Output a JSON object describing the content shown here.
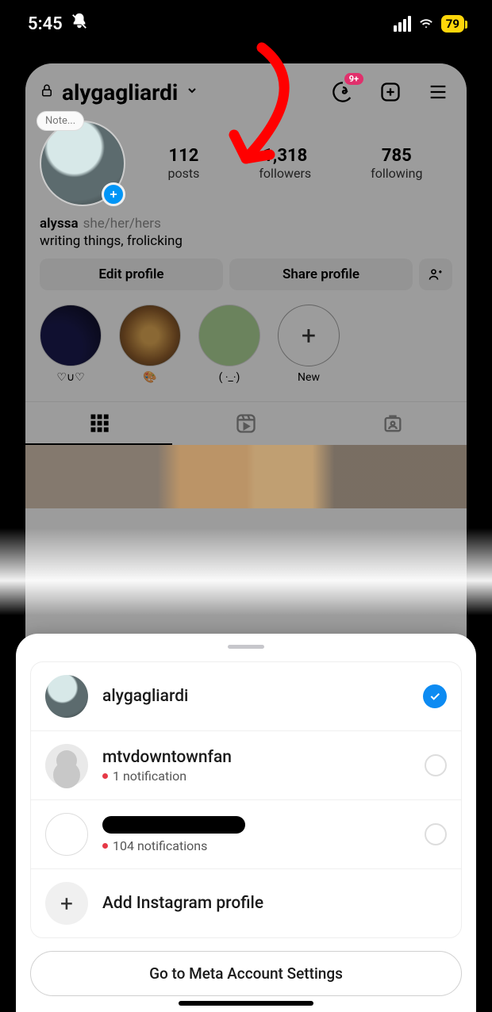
{
  "status": {
    "time": "5:45",
    "battery": "79"
  },
  "header": {
    "username": "alygagliardi",
    "threads_badge": "9+"
  },
  "stats": {
    "posts_count": "112",
    "posts_label": "posts",
    "followers_count": "1,318",
    "followers_label": "followers",
    "following_count": "785",
    "following_label": "following"
  },
  "bio": {
    "display_name": "alyssa",
    "pronouns": "she/her/hers",
    "text": "writing things, frolicking",
    "note_placeholder": "Note..."
  },
  "actions": {
    "edit_profile": "Edit profile",
    "share_profile": "Share profile"
  },
  "highlights": [
    {
      "label": "♡∪♡"
    },
    {
      "label": "🎨"
    },
    {
      "label": "( ·_·)"
    },
    {
      "label": "New"
    }
  ],
  "sheet": {
    "accounts": [
      {
        "name": "alygagliardi",
        "selected": true
      },
      {
        "name": "mtvdowntownfan",
        "notif": "1 notification"
      },
      {
        "name": "",
        "redacted": true,
        "notif": "104 notifications"
      }
    ],
    "add_profile": "Add Instagram profile",
    "meta_settings": "Go to Meta Account Settings"
  }
}
